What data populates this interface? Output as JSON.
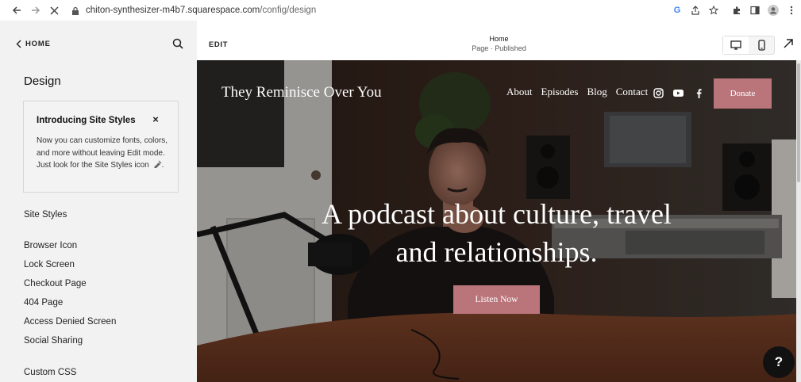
{
  "browser": {
    "url_domain": "chiton-synthesizer-m4b7.squarespace.com",
    "url_path": "/config/design",
    "icons": [
      "back-icon",
      "forward-icon",
      "reload-icon",
      "lock-icon",
      "google-icon",
      "share-icon",
      "star-icon",
      "extensions-icon",
      "sidebar-icon",
      "profile-icon",
      "more-icon"
    ]
  },
  "sidebar": {
    "home_label": "HOME",
    "title": "Design",
    "intro": {
      "title": "Introducing Site Styles",
      "body": "Now you can customize fonts, colors, and more without leaving Edit mode. Just look for the Site Styles icon"
    },
    "items": [
      {
        "label": "Site Styles"
      },
      {
        "label": "Browser Icon"
      },
      {
        "label": "Lock Screen"
      },
      {
        "label": "Checkout Page"
      },
      {
        "label": "404 Page"
      },
      {
        "label": "Access Denied Screen"
      },
      {
        "label": "Social Sharing"
      },
      {
        "label": "Custom CSS"
      }
    ]
  },
  "editor": {
    "edit_label": "EDIT",
    "page_title": "Home",
    "page_status": "Page · Published"
  },
  "site": {
    "title": "They Reminisce Over You",
    "nav": [
      "About",
      "Episodes",
      "Blog",
      "Contact"
    ],
    "social_icons": [
      "instagram-icon",
      "youtube-icon",
      "facebook-icon"
    ],
    "donate_label": "Donate",
    "hero_line1": "A podcast about culture, travel",
    "hero_line2": "and relationships.",
    "cta_label": "Listen Now",
    "accent_color": "#b9757a"
  },
  "help_label": "?"
}
